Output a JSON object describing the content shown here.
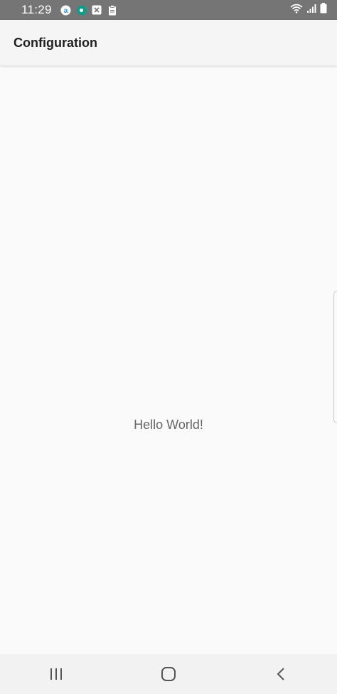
{
  "status_bar": {
    "time": "11:29",
    "notifications": [
      "app-a-icon",
      "location-app-icon",
      "close-box-icon",
      "clipboard-icon"
    ],
    "indicators": [
      "wifi-icon",
      "signal-icon",
      "battery-icon"
    ]
  },
  "app_bar": {
    "title": "Configuration"
  },
  "main": {
    "message": "Hello World!"
  },
  "nav_bar": {
    "buttons": [
      "recent-apps",
      "home",
      "back"
    ]
  },
  "colors": {
    "status_bar_bg": "#757575",
    "app_bar_bg": "#f5f5f5",
    "content_bg": "#fafafa",
    "text_primary": "#212121",
    "text_secondary": "#666666"
  }
}
